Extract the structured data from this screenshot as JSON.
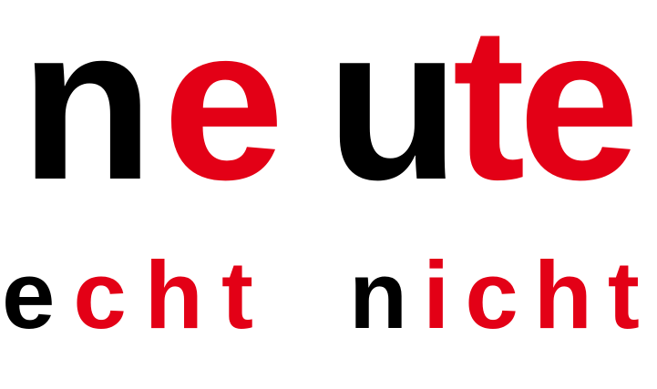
{
  "colors": {
    "black": "#000000",
    "red": "#e30016"
  },
  "line1": {
    "word1": {
      "black": "n",
      "red": "e"
    },
    "word2": {
      "black": "u",
      "red": "te"
    }
  },
  "line2": {
    "word1": {
      "black": "e",
      "red": "cht"
    },
    "word2": {
      "black": "n",
      "red": "icht"
    }
  }
}
